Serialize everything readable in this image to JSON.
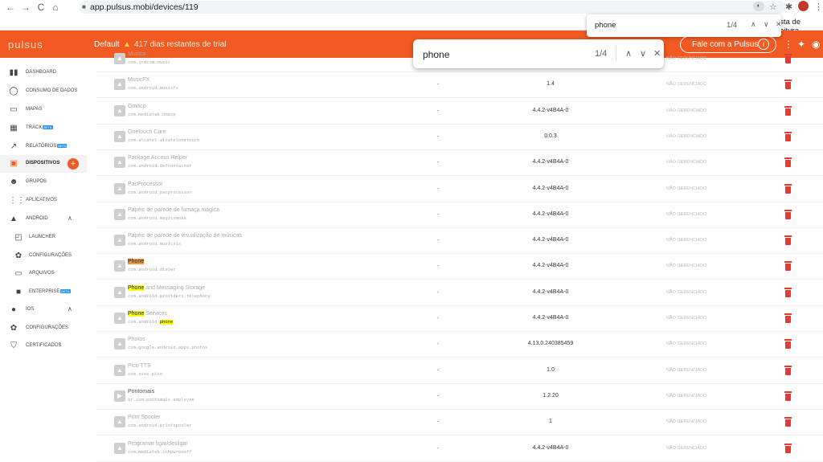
{
  "browser": {
    "url": "app.pulsus.mobi/devices/119",
    "reading_list": "ista de leitura",
    "ext_badge": "◐",
    "find_small": {
      "query": "phone",
      "count": "1/4"
    }
  },
  "header": {
    "logo": "pulsus",
    "plan": "Default",
    "trial_text": "417 dias restantes de trial",
    "talk_button": "Fale com a Pulsus",
    "brand_color": "#f15a22"
  },
  "find": {
    "query": "phone",
    "count": "1/4"
  },
  "sidebar": {
    "items": [
      {
        "label": "DASHBOARD",
        "icon": "bar-chart-icon",
        "glyph": "▮▮"
      },
      {
        "label": "CONSUMO DE DADOS",
        "icon": "data-usage-icon",
        "glyph": "◯"
      },
      {
        "label": "MAPAS",
        "icon": "map-icon",
        "glyph": "▭"
      },
      {
        "label": "TRACK",
        "beta": "BETA",
        "icon": "track-map-icon",
        "glyph": "▦"
      },
      {
        "label": "RELATÓRIOS",
        "beta": "BETA",
        "icon": "trend-icon",
        "glyph": "↗"
      },
      {
        "label": "DISPOSITIVOS",
        "icon": "devices-icon",
        "glyph": "▣"
      },
      {
        "label": "GRUPOS",
        "icon": "groups-icon",
        "glyph": "☻"
      },
      {
        "label": "APLICATIVOS",
        "icon": "apps-grid-icon",
        "glyph": "⋮⋮"
      },
      {
        "label": "ANDROID",
        "icon": "android-icon",
        "glyph": "▲"
      },
      {
        "label": "LAUNCHER",
        "icon": "launcher-icon",
        "glyph": "◰"
      },
      {
        "label": "CONFIGURAÇÕES",
        "icon": "settings-icon",
        "glyph": "✿"
      },
      {
        "label": "ARQUIVOS",
        "icon": "folder-icon",
        "glyph": "▭"
      },
      {
        "label": "ENTERPRISE",
        "beta": "BETA",
        "icon": "briefcase-icon",
        "glyph": "■"
      },
      {
        "label": "IOS",
        "icon": "apple-icon",
        "glyph": "●"
      },
      {
        "label": "CONFIGURAÇÕES",
        "icon": "settings-icon",
        "glyph": "✿"
      },
      {
        "label": "CERTIFICADOS",
        "icon": "shield-icon",
        "glyph": "⛉"
      }
    ]
  },
  "table": {
    "rows": [
      {
        "name": "Musica",
        "pkg": "com.jrdcom.music",
        "dash": "",
        "version": "",
        "status": "NÃO GERENCIADO"
      },
      {
        "name": "MusicFX",
        "pkg": "com.android.musicfx",
        "dash": "-",
        "version": "1.4",
        "status": "NÃO GERENCIADO"
      },
      {
        "name": "Omacp",
        "pkg": "com.mediatek.omacp",
        "dash": "-",
        "version": "4.4.2-v4B4A-0",
        "status": "NÃO GERENCIADO"
      },
      {
        "name": "Onetouch Care",
        "pkg": "com.alcatel.alcatelonetouch",
        "dash": "-",
        "version": "0.0.3",
        "status": "NÃO GERENCIADO"
      },
      {
        "name": "Package Access Helper",
        "pkg": "com.android.defcontainer",
        "dash": "-",
        "version": "4.4.2-v4B4A-0",
        "status": "NÃO GERENCIADO"
      },
      {
        "name": "PacProcessor",
        "pkg": "com.android.pacprocessor",
        "dash": "-",
        "version": "4.4.2-v4B4A-0",
        "status": "NÃO GERENCIADO"
      },
      {
        "name": "Papéis de parede de fumaça mágica",
        "pkg": "com.android.magicsmoke",
        "dash": "-",
        "version": "4.4.2-v4B4A-0",
        "status": "NÃO GERENCIADO"
      },
      {
        "name": "Papéis de parede de visualização de músicas",
        "pkg": "com.android.musicvis",
        "dash": "-",
        "version": "4.4.2-v4B4A-0",
        "status": "NÃO GERENCIADO"
      },
      {
        "name_hl": "Phone",
        "hl_class": "hl-cur",
        "name_rest": "",
        "pkg": "com.android.dialer",
        "dash": "-",
        "version": "4.4.2-v4B4A-0",
        "status": "NÃO GERENCIADO"
      },
      {
        "name_hl": "Phone",
        "hl_class": "hl",
        "name_rest": " and Messaging Storage",
        "pkg": "com.android.providers.telephony",
        "dash": "-",
        "version": "4.4.2-v4B4A-0",
        "status": "NÃO GERENCIADO"
      },
      {
        "name_hl": "Phone",
        "hl_class": "hl",
        "name_rest": " Services",
        "pkg_pre": "com.android.",
        "pkg_hl": "phone",
        "dash": "-",
        "version": "4.4.2-v4B4A-0",
        "status": "NÃO GERENCIADO"
      },
      {
        "name": "Photos",
        "pkg": "com.google.android.apps.photos",
        "dash": "-",
        "version": "4.13.0.240385459",
        "status": "NÃO GERENCIADO"
      },
      {
        "name": "Pico TTS",
        "pkg": "com.svox.pico",
        "dash": "-",
        "version": "1.0",
        "status": "NÃO GERENCIADO"
      },
      {
        "name": "Pontomais",
        "pkg": "br.com.pontomais.employee",
        "dash": "-",
        "version": "1.2.20",
        "status": "NÃO GERENCIADO",
        "installed": true,
        "icon_glyph": "▶"
      },
      {
        "name": "Print Spooler",
        "pkg": "com.android.printspooler",
        "dash": "-",
        "version": "1",
        "status": "NÃO GERENCIADO"
      },
      {
        "name": "Programar ligar/desligar",
        "pkg": "com.mediatek.schpwronoff",
        "dash": "-",
        "version": "4.4.2-v4B4A-0",
        "status": "NÃO GERENCIADO"
      }
    ],
    "default_icon_glyph": "▲",
    "delete_color": "#e53935"
  }
}
